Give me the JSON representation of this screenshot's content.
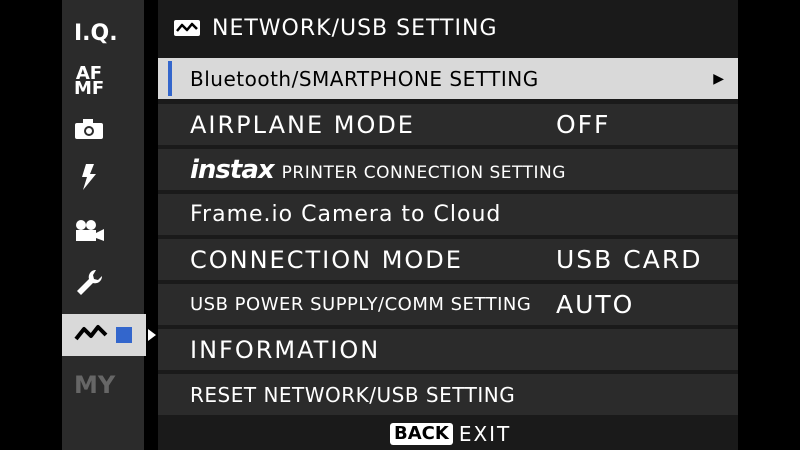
{
  "sidebar": {
    "items": [
      {
        "label": "I.Q.",
        "icon": "image-quality-icon"
      },
      {
        "label": "AF MF",
        "icon": "focus-icon"
      },
      {
        "label": "",
        "icon": "camera-icon"
      },
      {
        "label": "",
        "icon": "flash-icon"
      },
      {
        "label": "",
        "icon": "movie-icon"
      },
      {
        "label": "",
        "icon": "wrench-icon"
      },
      {
        "label": "",
        "icon": "network-icon"
      },
      {
        "label": "MY",
        "icon": "my-menu-icon"
      }
    ],
    "active_index": 6,
    "accent_color": "#3366cc"
  },
  "header": {
    "title": "NETWORK/USB SETTING",
    "icon": "network-icon"
  },
  "menu": {
    "rows": [
      {
        "label": "Bluetooth/SMARTPHONE SETTING",
        "value": "",
        "selected": true,
        "has_submenu": true
      },
      {
        "label": "AIRPLANE MODE",
        "value": "OFF"
      },
      {
        "label_brand": "instax",
        "label": "PRINTER CONNECTION SETTING",
        "value": ""
      },
      {
        "label": "Frame.io Camera to Cloud",
        "value": ""
      },
      {
        "label": "CONNECTION MODE",
        "value": "USB CARD"
      },
      {
        "label": "USB POWER SUPPLY/COMM SETTING",
        "value": "AUTO"
      },
      {
        "label": "INFORMATION",
        "value": ""
      },
      {
        "label": "RESET NETWORK/USB SETTING",
        "value": ""
      }
    ]
  },
  "footer": {
    "back_label": "BACK",
    "exit_label": "EXIT"
  }
}
